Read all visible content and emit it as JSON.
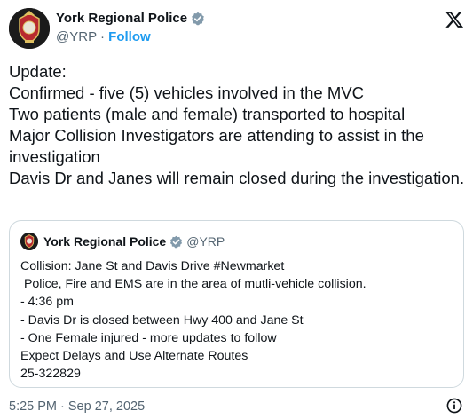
{
  "author": {
    "name": "York Regional Police",
    "handle": "@YRP",
    "separator": " · ",
    "follow_label": "Follow"
  },
  "tweet": {
    "lines": [
      "Update:",
      "Confirmed - five (5) vehicles involved in the MVC",
      "Two patients (male and female) transported to hospital",
      "Major Collision Investigators are attending to assist in the investigation",
      "Davis Dr and Janes will remain closed during the investigation."
    ]
  },
  "quote": {
    "name": "York Regional Police",
    "handle": "@YRP",
    "lines": [
      "Collision: Jane St and Davis Drive #Newmarket",
      " Police, Fire and EMS are in the area of mutli-vehicle collision.",
      "- 4:36 pm",
      "- Davis Dr is closed between Hwy 400 and Jane St",
      "- One Female injured - more updates to follow",
      "Expect Delays and Use Alternate Routes",
      "25-322829"
    ]
  },
  "footer": {
    "timestamp": "5:25 PM · Sep 27, 2025"
  },
  "colors": {
    "accent": "#1d9bf0",
    "verified": "#829aab",
    "muted": "#536471",
    "border": "#cfd9de"
  },
  "icons": {
    "verified": "verified-badge-icon",
    "x_logo": "x-logo-icon",
    "info": "info-icon"
  }
}
